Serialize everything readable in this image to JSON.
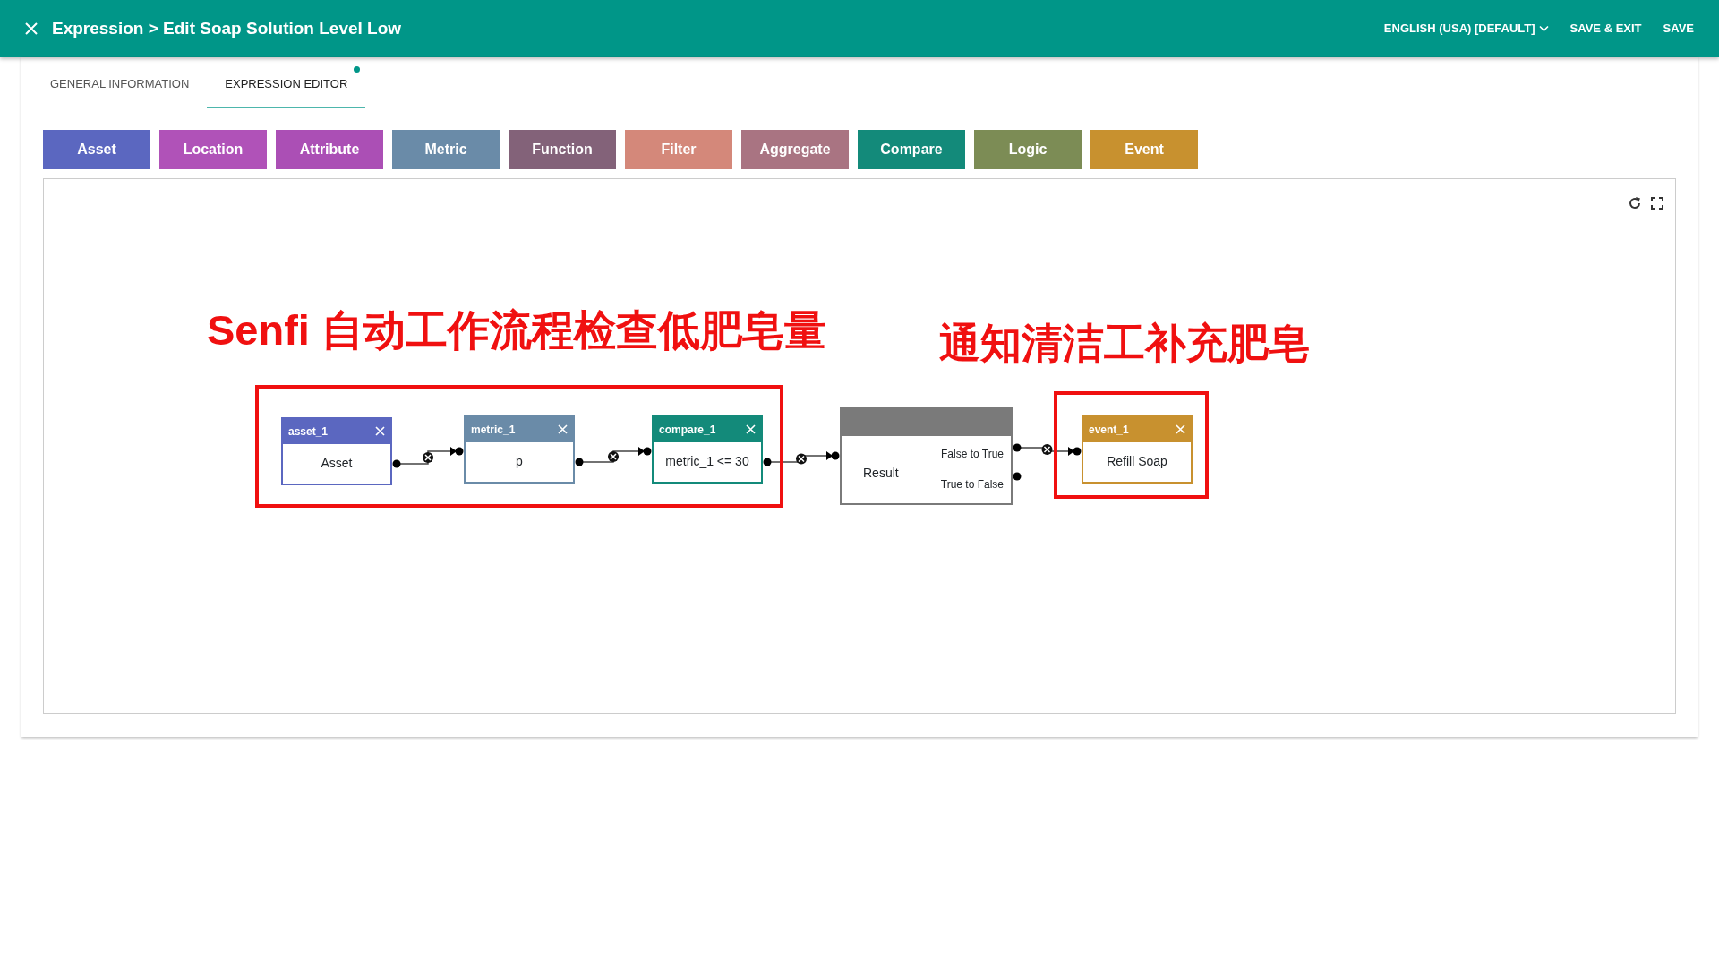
{
  "header": {
    "title": "Expression > Edit Soap Solution Level Low",
    "language": "ENGLISH (USA) [DEFAULT]",
    "actions": [
      "SAVE & EXIT",
      "SAVE"
    ]
  },
  "tabs": [
    {
      "label": "GENERAL INFORMATION",
      "selected": false,
      "modified": false
    },
    {
      "label": "EXPRESSION EDITOR",
      "selected": true,
      "modified": true
    }
  ],
  "palette": [
    {
      "label": "Asset",
      "color": "#5b67c0"
    },
    {
      "label": "Location",
      "color": "#b052b8"
    },
    {
      "label": "Attribute",
      "color": "#ab4fb5"
    },
    {
      "label": "Metric",
      "color": "#6a8ba8"
    },
    {
      "label": "Function",
      "color": "#836279"
    },
    {
      "label": "Filter",
      "color": "#d4887a"
    },
    {
      "label": "Aggregate",
      "color": "#a97482"
    },
    {
      "label": "Compare",
      "color": "#138a7a"
    },
    {
      "label": "Logic",
      "color": "#7c8c55"
    },
    {
      "label": "Event",
      "color": "#c8912f"
    }
  ],
  "annotations": [
    {
      "text": "Senfi 自动工作流程检查低肥皂量"
    },
    {
      "text": "通知清洁工补充肥皂"
    }
  ],
  "nodes": [
    {
      "kind": "block",
      "name": "asset_1",
      "body": "Asset",
      "color": "#5b67c0"
    },
    {
      "kind": "block",
      "name": "metric_1",
      "body": "p",
      "color": "#6a8ba8"
    },
    {
      "kind": "block",
      "name": "compare_1",
      "body": "metric_1 <= 30",
      "color": "#138a7a"
    },
    {
      "kind": "result",
      "body": "Result",
      "outputs": [
        "False to True",
        "True to False"
      ]
    },
    {
      "kind": "block",
      "name": "event_1",
      "body": "Refill Soap",
      "color": "#c8912f"
    }
  ]
}
